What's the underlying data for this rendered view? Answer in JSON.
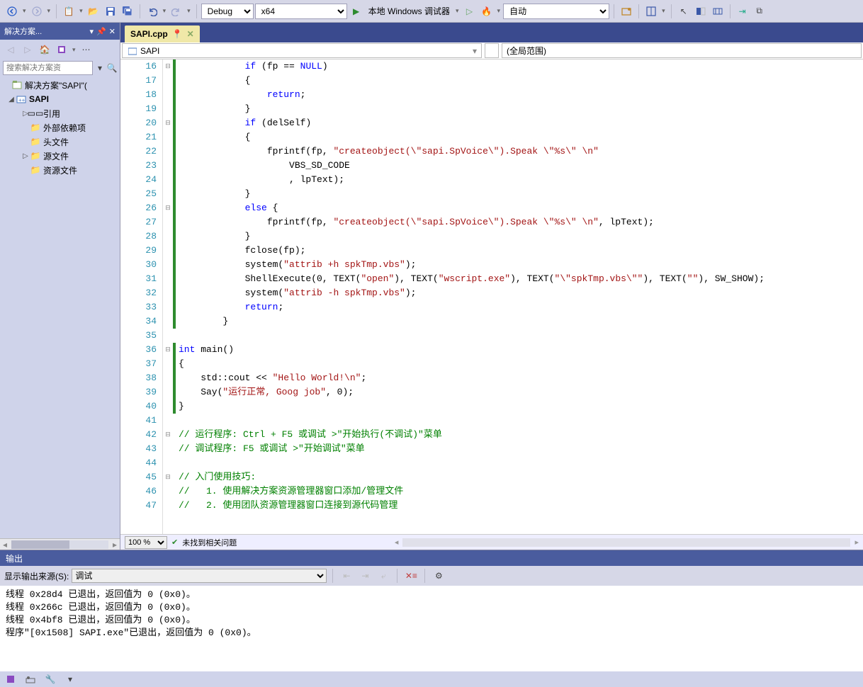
{
  "toolbar": {
    "config": "Debug",
    "platform": "x64",
    "debugger_label": "本地 Windows 调试器",
    "mode": "自动"
  },
  "solution_explorer": {
    "title": "解决方案...",
    "search_placeholder": "搜索解决方案资",
    "root": "解决方案\"SAPI\"(",
    "project": "SAPI",
    "nodes": {
      "references": "引用",
      "external": "外部依赖项",
      "headers": "头文件",
      "sources": "源文件",
      "resources": "资源文件"
    }
  },
  "tab": {
    "name": "SAPI.cpp"
  },
  "navbar": {
    "scope": "SAPI",
    "member": "(全局范围)"
  },
  "code": {
    "lines": [
      {
        "n": 16,
        "fold": "-",
        "segs": [
          [
            "ident",
            "            "
          ],
          [
            "kw",
            "if"
          ],
          [
            "ident",
            " (fp == "
          ],
          [
            "kw",
            "NULL"
          ],
          [
            "ident",
            ")"
          ]
        ]
      },
      {
        "n": 17,
        "segs": [
          [
            "ident",
            "            {"
          ]
        ]
      },
      {
        "n": 18,
        "segs": [
          [
            "ident",
            "                "
          ],
          [
            "kw",
            "return"
          ],
          [
            "ident",
            ";"
          ]
        ]
      },
      {
        "n": 19,
        "segs": [
          [
            "ident",
            "            }"
          ]
        ]
      },
      {
        "n": 20,
        "fold": "-",
        "segs": [
          [
            "ident",
            "            "
          ],
          [
            "kw",
            "if"
          ],
          [
            "ident",
            " (delSelf)"
          ]
        ]
      },
      {
        "n": 21,
        "segs": [
          [
            "ident",
            "            {"
          ]
        ]
      },
      {
        "n": 22,
        "segs": [
          [
            "ident",
            "                fprintf(fp, "
          ],
          [
            "str",
            "\"createobject(\\\"sapi.SpVoice\\\").Speak \\\"%s\\\" \\n\""
          ]
        ]
      },
      {
        "n": 23,
        "segs": [
          [
            "ident",
            "                    VBS_SD_CODE"
          ]
        ]
      },
      {
        "n": 24,
        "segs": [
          [
            "ident",
            "                    , lpText);"
          ]
        ]
      },
      {
        "n": 25,
        "segs": [
          [
            "ident",
            "            }"
          ]
        ]
      },
      {
        "n": 26,
        "fold": "-",
        "segs": [
          [
            "ident",
            "            "
          ],
          [
            "kw",
            "else"
          ],
          [
            "ident",
            " {"
          ]
        ]
      },
      {
        "n": 27,
        "segs": [
          [
            "ident",
            "                fprintf(fp, "
          ],
          [
            "str",
            "\"createobject(\\\"sapi.SpVoice\\\").Speak \\\"%s\\\" \\n\""
          ],
          [
            "ident",
            ", lpText);"
          ]
        ]
      },
      {
        "n": 28,
        "segs": [
          [
            "ident",
            "            }"
          ]
        ]
      },
      {
        "n": 29,
        "segs": [
          [
            "ident",
            "            fclose(fp);"
          ]
        ]
      },
      {
        "n": 30,
        "segs": [
          [
            "ident",
            "            system("
          ],
          [
            "str",
            "\"attrib +h spkTmp.vbs\""
          ],
          [
            "ident",
            ");"
          ]
        ]
      },
      {
        "n": 31,
        "segs": [
          [
            "ident",
            "            ShellExecute(0, TEXT("
          ],
          [
            "str",
            "\"open\""
          ],
          [
            "ident",
            "), TEXT("
          ],
          [
            "str",
            "\"wscript.exe\""
          ],
          [
            "ident",
            "), TEXT("
          ],
          [
            "str",
            "\"\\\"spkTmp.vbs\\\"\""
          ],
          [
            "ident",
            "), TEXT("
          ],
          [
            "str",
            "\"\""
          ],
          [
            "ident",
            "), SW_SHOW);"
          ]
        ]
      },
      {
        "n": 32,
        "segs": [
          [
            "ident",
            "            system("
          ],
          [
            "str",
            "\"attrib -h spkTmp.vbs\""
          ],
          [
            "ident",
            ");"
          ]
        ]
      },
      {
        "n": 33,
        "segs": [
          [
            "ident",
            "            "
          ],
          [
            "kw",
            "return"
          ],
          [
            "ident",
            ";"
          ]
        ]
      },
      {
        "n": 34,
        "segs": [
          [
            "ident",
            "        }"
          ]
        ]
      },
      {
        "n": 35,
        "segs": [
          [
            "ident",
            ""
          ]
        ]
      },
      {
        "n": 36,
        "fold": "-",
        "segs": [
          [
            "kw",
            "int"
          ],
          [
            "ident",
            " main()"
          ]
        ]
      },
      {
        "n": 37,
        "segs": [
          [
            "ident",
            "{"
          ]
        ]
      },
      {
        "n": 38,
        "segs": [
          [
            "ident",
            "    std::cout << "
          ],
          [
            "str",
            "\"Hello World!\\n\""
          ],
          [
            "ident",
            ";"
          ]
        ]
      },
      {
        "n": 39,
        "segs": [
          [
            "ident",
            "    Say("
          ],
          [
            "str",
            "\"运行正常, Goog job\""
          ],
          [
            "ident",
            ", 0);"
          ]
        ]
      },
      {
        "n": 40,
        "segs": [
          [
            "ident",
            "}"
          ]
        ]
      },
      {
        "n": 41,
        "segs": [
          [
            "ident",
            ""
          ]
        ]
      },
      {
        "n": 42,
        "fold": "-",
        "segs": [
          [
            "cmt",
            "// 运行程序: Ctrl + F5 或调试 >\"开始执行(不调试)\"菜单"
          ]
        ]
      },
      {
        "n": 43,
        "segs": [
          [
            "cmt",
            "// 调试程序: F5 或调试 >\"开始调试\"菜单"
          ]
        ]
      },
      {
        "n": 44,
        "segs": [
          [
            "ident",
            ""
          ]
        ]
      },
      {
        "n": 45,
        "fold": "-",
        "segs": [
          [
            "cmt",
            "// 入门使用技巧:"
          ]
        ]
      },
      {
        "n": 46,
        "segs": [
          [
            "cmt",
            "//   1. 使用解决方案资源管理器窗口添加/管理文件"
          ]
        ]
      },
      {
        "n": 47,
        "segs": [
          [
            "cmt",
            "//   2. 使用团队资源管理器窗口连接到源代码管理"
          ]
        ]
      }
    ]
  },
  "status": {
    "zoom": "100 %",
    "issues": "未找到相关问题"
  },
  "output": {
    "title": "输出",
    "source_label": "显示输出来源(S):",
    "source": "调试",
    "lines": [
      "线程 0x28d4 已退出，返回值为 0 (0x0)。",
      "线程 0x266c 已退出，返回值为 0 (0x0)。",
      "线程 0x4bf8 已退出，返回值为 0 (0x0)。",
      "程序\"[0x1508] SAPI.exe\"已退出，返回值为 0 (0x0)。"
    ]
  }
}
